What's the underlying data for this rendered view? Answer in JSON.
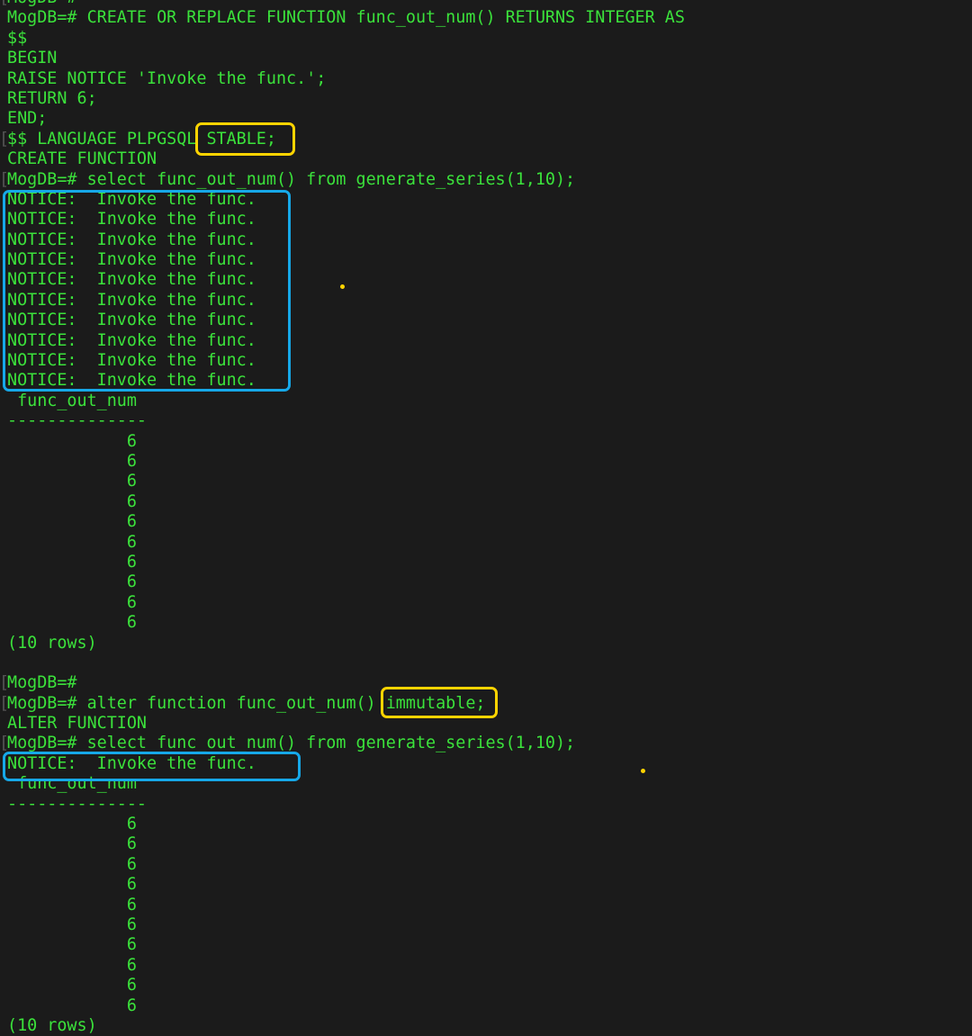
{
  "terminal": {
    "lines": [
      "MogDB=#",
      "MogDB=# CREATE OR REPLACE FUNCTION func_out_num() RETURNS INTEGER AS",
      "$$",
      "BEGIN",
      "RAISE NOTICE 'Invoke the func.';",
      "RETURN 6;",
      "END;",
      "$$ LANGUAGE PLPGSQL STABLE;",
      "CREATE FUNCTION",
      "MogDB=# select func_out_num() from generate_series(1,10);",
      "NOTICE:  Invoke the func.",
      "NOTICE:  Invoke the func.",
      "NOTICE:  Invoke the func.",
      "NOTICE:  Invoke the func.",
      "NOTICE:  Invoke the func.",
      "NOTICE:  Invoke the func.",
      "NOTICE:  Invoke the func.",
      "NOTICE:  Invoke the func.",
      "NOTICE:  Invoke the func.",
      "NOTICE:  Invoke the func.",
      " func_out_num",
      "--------------",
      "            6",
      "            6",
      "            6",
      "            6",
      "            6",
      "            6",
      "            6",
      "            6",
      "            6",
      "            6",
      "(10 rows)",
      "",
      "MogDB=#",
      "MogDB=# alter function func_out_num() immutable;",
      "ALTER FUNCTION",
      "MogDB=# select func_out_num() from generate_series(1,10);",
      "NOTICE:  Invoke the func.",
      " func_out_num",
      "--------------",
      "            6",
      "            6",
      "            6",
      "            6",
      "            6",
      "            6",
      "            6",
      "            6",
      "            6",
      "            6",
      "(10 rows)"
    ],
    "bracket_lines": [
      0,
      7,
      9,
      34,
      35,
      37
    ]
  },
  "colors": {
    "text": "#3be23b",
    "background": "#1b1b1b",
    "highlight_yellow": "#ffd400",
    "highlight_blue": "#16a8e8"
  }
}
